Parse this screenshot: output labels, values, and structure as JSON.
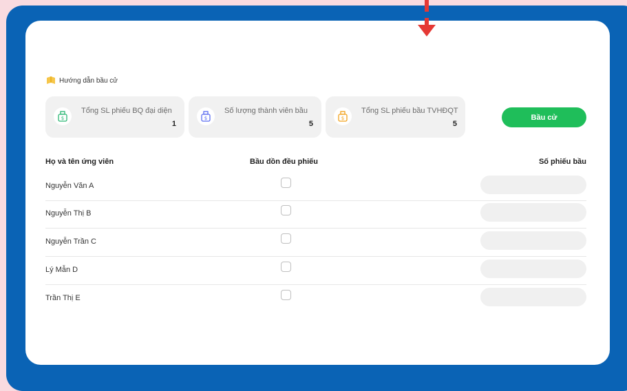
{
  "guide": {
    "label": "Hướng dẫn bầu cử"
  },
  "stats": [
    {
      "label": "Tổng SL phiếu BQ đại diện",
      "value": "1",
      "icon_color": "#2bb673",
      "icon": "ballot-box-icon"
    },
    {
      "label": "Số lượng thành viên bầu",
      "value": "5",
      "icon_color": "#5b6cf0",
      "icon": "ballot-box-icon"
    },
    {
      "label": "Tổng SL phiếu bầu TVHĐQT",
      "value": "5",
      "icon_color": "#f2a21b",
      "icon": "ballot-box-icon"
    }
  ],
  "vote_button": {
    "label": "Bầu cử",
    "color": "#1fbe5a"
  },
  "table": {
    "headers": [
      "Họ và tên ứng viên",
      "Bầu dồn đều phiếu",
      "Số phiếu bầu"
    ],
    "rows": [
      {
        "name": "Nguyễn Văn A",
        "checked": false,
        "votes": ""
      },
      {
        "name": "Nguyễn Thị B",
        "checked": false,
        "votes": ""
      },
      {
        "name": "Nguyễn Trần C",
        "checked": false,
        "votes": ""
      },
      {
        "name": "Lý Mẫn D",
        "checked": false,
        "votes": ""
      },
      {
        "name": "Trần Thị E",
        "checked": false,
        "votes": ""
      }
    ]
  },
  "colors": {
    "frame": "#0a63b5",
    "background": "#f9dbe0",
    "arrow": "#e53935"
  }
}
